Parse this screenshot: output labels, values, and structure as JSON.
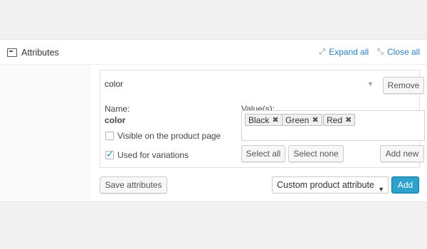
{
  "header": {
    "title": "Attributes",
    "expand_all": "Expand all",
    "close_all": "Close all"
  },
  "attribute": {
    "name_top": "color",
    "remove_label": "Remove",
    "name_label": "Name:",
    "name_value": "color",
    "values_label": "Value(s):",
    "values": [
      "Black",
      "Green",
      "Red"
    ],
    "visible_label": "Visible on the product page",
    "visible_checked": false,
    "variations_label": "Used for variations",
    "variations_checked": true,
    "select_all_label": "Select all",
    "select_none_label": "Select none",
    "add_new_label": "Add new"
  },
  "footer": {
    "save_label": "Save attributes",
    "select_value": "Custom product attribute",
    "add_label": "Add"
  },
  "colors": {
    "link": "#2a7fb8",
    "primary": "#2ea2cc",
    "checkmark": "#1e8cbe"
  }
}
